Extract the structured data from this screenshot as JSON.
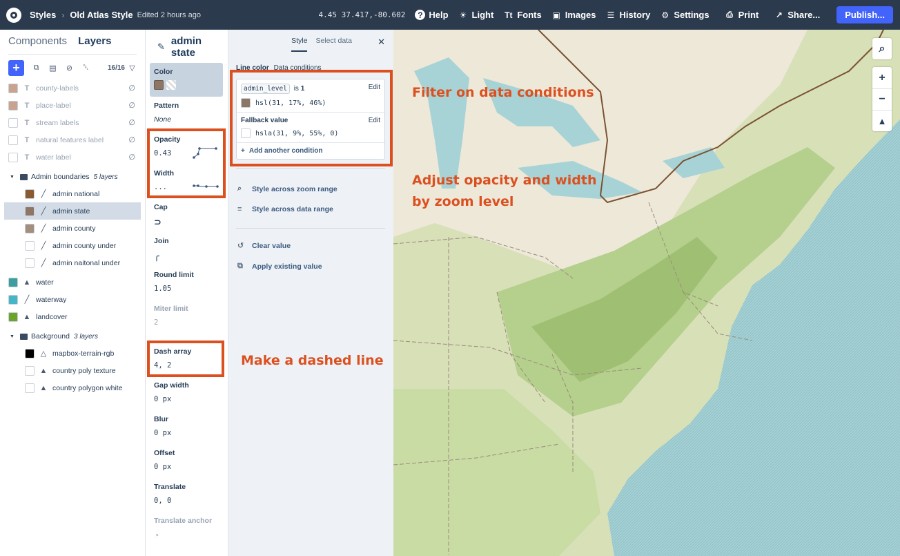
{
  "topbar": {
    "crumb": "Styles",
    "style_name": "Old Atlas Style",
    "edited": "Edited 2 hours ago",
    "coords": "4.45 37.417,-80.602",
    "help": "Help",
    "light": "Light",
    "fonts": "Fonts",
    "images": "Images",
    "history": "History",
    "settings": "Settings",
    "print": "Print",
    "share": "Share...",
    "publish": "Publish..."
  },
  "left": {
    "tab_components": "Components",
    "tab_layers": "Layers",
    "count": "16/16",
    "layers_top": [
      {
        "name": "county-labels",
        "color": "#c9a38d"
      },
      {
        "name": "place-label",
        "color": "#c9a38d"
      },
      {
        "name": "stream labels",
        "color": "#ffffff"
      },
      {
        "name": "natural features label",
        "color": "#ffffff"
      },
      {
        "name": "water label",
        "color": "#ffffff"
      }
    ],
    "group_admin": {
      "name": "Admin boundaries",
      "count": "5 layers"
    },
    "admin_layers": [
      {
        "name": "admin national",
        "color": "#8a5a32"
      },
      {
        "name": "admin state",
        "color": "#8c7666"
      },
      {
        "name": "admin county",
        "color": "#a38f80"
      },
      {
        "name": "admin county under",
        "color": "#ffffff"
      },
      {
        "name": "admin naitonal under",
        "color": "#ffffff"
      }
    ],
    "mid_layers": [
      {
        "name": "water",
        "color": "#3d9ea0"
      },
      {
        "name": "waterway",
        "color": "#46b5c6"
      },
      {
        "name": "landcover",
        "color": "#6aa52a"
      }
    ],
    "group_background": {
      "name": "Background",
      "count": "3 layers"
    },
    "bg_layers": [
      {
        "name": "mapbox-terrain-rgb",
        "color": "#000000"
      },
      {
        "name": "country poly texture",
        "color": "#ffffff"
      },
      {
        "name": "country polygon white",
        "color": "#ffffff"
      }
    ]
  },
  "props": {
    "title": "admin state",
    "color_label": "Color",
    "pattern_label": "Pattern",
    "pattern_value": "None",
    "opacity_label": "Opacity",
    "opacity_value": "0.43",
    "width_label": "Width",
    "width_value": "...",
    "cap_label": "Cap",
    "join_label": "Join",
    "round_label": "Round limit",
    "round_value": "1.05",
    "miter_label": "Miter limit",
    "miter_value": "2",
    "dash_label": "Dash array",
    "dash_value": "4, 2",
    "gap_label": "Gap width",
    "gap_value": "0 px",
    "blur_label": "Blur",
    "blur_value": "0 px",
    "offset_label": "Offset",
    "offset_value": "0 px",
    "translate_label": "Translate",
    "translate_value": "0, 0",
    "anchor_label": "Translate anchor"
  },
  "detail": {
    "tab_style": "Style",
    "tab_select": "Select data",
    "head_bold": "Line color",
    "head_rest": "Data conditions",
    "cond1_field": "admin_level",
    "cond1_is": "is",
    "cond1_value": "1",
    "cond1_color": "hsl(31, 17%, 46%)",
    "cond1_swatch": "#8c7666",
    "edit": "Edit",
    "fallback_label": "Fallback value",
    "fallback_color": "hsla(31, 9%, 55%, 0)",
    "add_condition": "Add another condition",
    "zoom_range": "Style across zoom range",
    "data_range": "Style across data range",
    "clear_value": "Clear value",
    "apply_value": "Apply existing value"
  },
  "annotations": {
    "filter": "Filter on data conditions",
    "opacity_line1": "Adjust opacity and width",
    "opacity_line2": "by zoom level",
    "dashed": "Make a dashed line",
    "color": "#dc5020"
  }
}
